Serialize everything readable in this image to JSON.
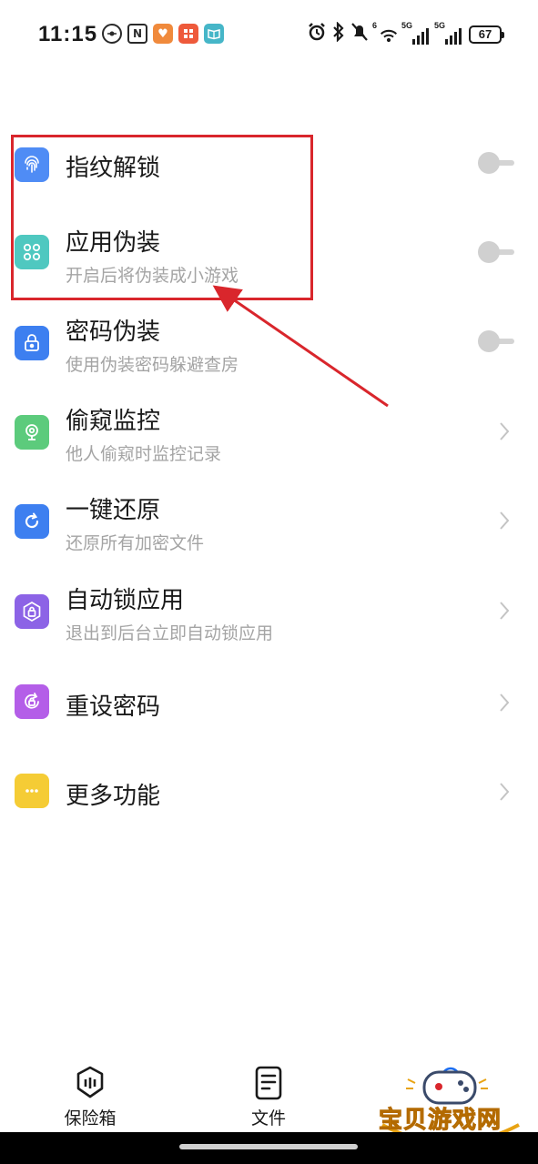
{
  "status_bar": {
    "time": "11:15",
    "notification_icons": [
      "oneplus-shelf-icon",
      "nfc-icon",
      "health-app-icon",
      "game-app-icon",
      "reader-app-icon"
    ],
    "nfc_letter": "N",
    "signal_tag_1": "5G",
    "signal_tag_2": "5G",
    "wifi_tag": "6",
    "battery_level": "67"
  },
  "settings": {
    "items": [
      {
        "title": "指纹解锁",
        "subtitle": "",
        "control": "toggle",
        "toggle_on": false,
        "icon": "fingerprint-icon",
        "icon_color": "#4f8cf5"
      },
      {
        "title": "应用伪装",
        "subtitle": "开启后将伪装成小游戏",
        "control": "toggle",
        "toggle_on": false,
        "icon": "grid-icon",
        "icon_color": "#4fc8c0"
      },
      {
        "title": "密码伪装",
        "subtitle": "使用伪装密码躲避查房",
        "control": "toggle",
        "toggle_on": false,
        "icon": "lock-icon",
        "icon_color": "#3d7ff0"
      },
      {
        "title": "偷窥监控",
        "subtitle": "他人偷窥时监控记录",
        "control": "chevron",
        "icon": "webcam-icon",
        "icon_color": "#5ccb7c"
      },
      {
        "title": "一键还原",
        "subtitle": "还原所有加密文件",
        "control": "chevron",
        "icon": "refresh-icon",
        "icon_color": "#3d7ff0"
      },
      {
        "title": "自动锁应用",
        "subtitle": "退出到后台立即自动锁应用",
        "control": "chevron",
        "icon": "hexagon-lock-icon",
        "icon_color": "#8c63e6"
      },
      {
        "title": "重设密码",
        "subtitle": "",
        "control": "chevron",
        "icon": "reset-password-icon",
        "icon_color": "#b45ee8"
      },
      {
        "title": "更多功能",
        "subtitle": "",
        "control": "chevron",
        "icon": "more-dots-icon",
        "icon_color": "#f5cc35"
      }
    ]
  },
  "bottom_nav": {
    "items": [
      {
        "label": "保险箱",
        "icon": "safe-icon"
      },
      {
        "label": "文件",
        "icon": "document-icon"
      },
      {
        "label": "",
        "icon": "settings-icon"
      }
    ]
  },
  "watermark": {
    "text": "宝贝游戏网",
    "url": "baobeiy.com"
  },
  "colors": {
    "annotation_red": "#d9262c",
    "subtitle_gray": "#a4a4a4",
    "toggle_off": "#d0d0d0"
  }
}
